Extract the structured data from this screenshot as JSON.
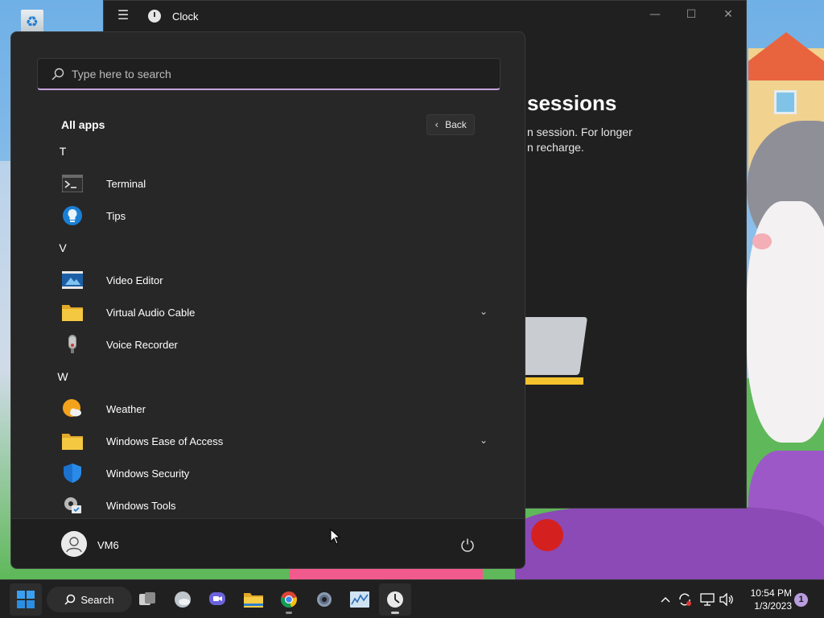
{
  "desktop": {
    "icons": [
      {
        "name": "recycle-bin",
        "label": ""
      }
    ]
  },
  "clock_window": {
    "title": "Clock",
    "heading": "sessions",
    "body_lines": [
      "n session. For longer",
      "n recharge."
    ],
    "controls": {
      "minimize": "—",
      "maximize": "☐",
      "close": "✕"
    }
  },
  "start_menu": {
    "search": {
      "placeholder": "Type here to search",
      "value": ""
    },
    "all_apps_title": "All apps",
    "back_label": "Back",
    "apps": [
      {
        "kind": "letter",
        "text": "T"
      },
      {
        "kind": "app",
        "label": "Terminal",
        "icon": "terminal-icon"
      },
      {
        "kind": "app",
        "label": "Tips",
        "icon": "tips-icon"
      },
      {
        "kind": "letter",
        "text": "V"
      },
      {
        "kind": "app",
        "label": "Video Editor",
        "icon": "video-editor-icon"
      },
      {
        "kind": "folder",
        "label": "Virtual Audio Cable",
        "icon": "folder-icon",
        "expandable": true
      },
      {
        "kind": "app",
        "label": "Voice Recorder",
        "icon": "voice-recorder-icon"
      },
      {
        "kind": "letter",
        "text": "W"
      },
      {
        "kind": "app",
        "label": "Weather",
        "icon": "weather-icon"
      },
      {
        "kind": "folder",
        "label": "Windows Ease of Access",
        "icon": "folder-icon",
        "expandable": true
      },
      {
        "kind": "app",
        "label": "Windows Security",
        "icon": "shield-icon"
      },
      {
        "kind": "app",
        "label": "Windows Tools",
        "icon": "windows-tools-icon"
      }
    ],
    "user": {
      "name": "VM6"
    }
  },
  "taskbar": {
    "search_label": "Search",
    "apps": [
      {
        "name": "task-view",
        "icon": "task-view-icon",
        "active": false
      },
      {
        "name": "widgets",
        "icon": "widgets-icon",
        "active": false
      },
      {
        "name": "chat",
        "icon": "chat-icon",
        "active": false
      },
      {
        "name": "file-explorer",
        "icon": "folder-icon",
        "active": false
      },
      {
        "name": "chrome",
        "icon": "chrome-icon",
        "active": false
      },
      {
        "name": "settings",
        "icon": "gear-icon",
        "active": false
      },
      {
        "name": "resource-monitor",
        "icon": "chart-icon",
        "active": false
      },
      {
        "name": "clock",
        "icon": "clock-icon",
        "active": true
      }
    ],
    "clock": {
      "time": "10:54 PM",
      "date": "1/3/2023"
    },
    "notification_count": "1"
  },
  "colors": {
    "menu_bg": "#272727",
    "accent": "#c9a6df",
    "taskbar_bg": "#202020"
  }
}
